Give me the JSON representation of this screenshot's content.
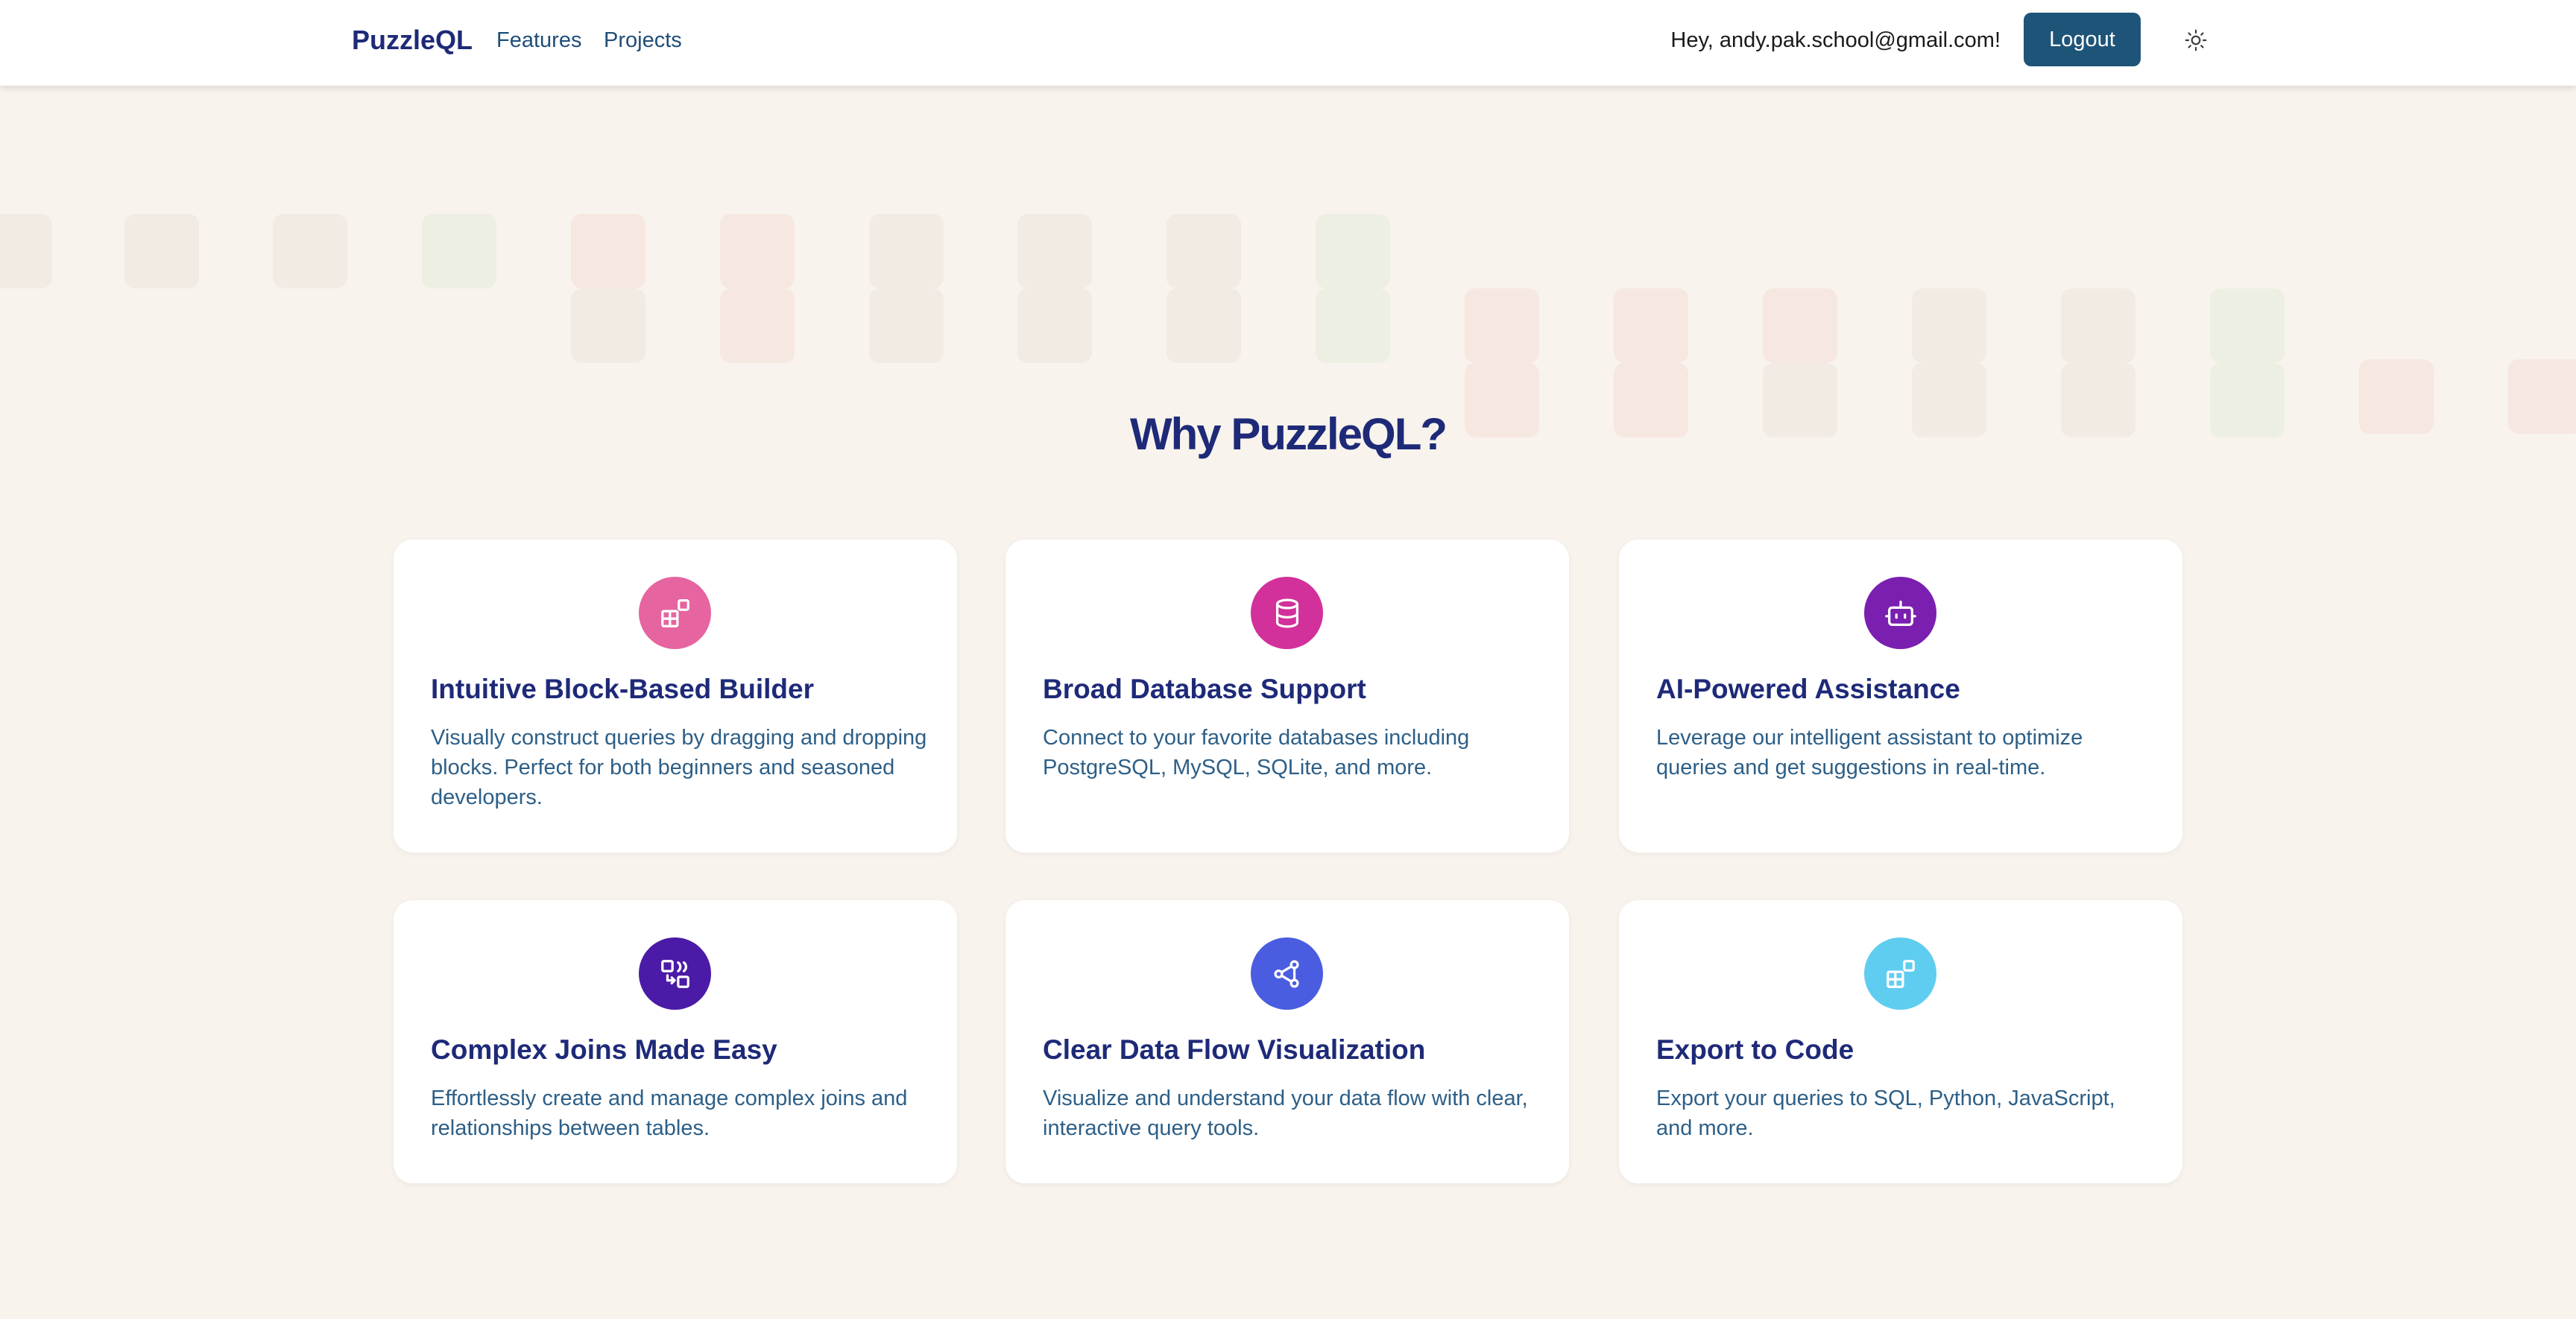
{
  "navbar": {
    "brand": "PuzzleQL",
    "links": [
      {
        "label": "Features"
      },
      {
        "label": "Projects"
      }
    ],
    "greeting": "Hey, andy.pak.school@gmail.com!",
    "logout_label": "Logout",
    "theme_icon": "sun-icon"
  },
  "section": {
    "title": "Why PuzzleQL?"
  },
  "features": [
    {
      "title": "Intuitive Block-Based Builder",
      "description": "Visually construct queries by dragging and dropping blocks. Perfect for both beginners and seasoned developers.",
      "icon": "blocks-icon",
      "icon_color": "#e6649f"
    },
    {
      "title": "Broad Database Support",
      "description": "Connect to your favorite databases including PostgreSQL, MySQL, SQLite, and more.",
      "icon": "database-icon",
      "icon_color": "#d2309a"
    },
    {
      "title": "AI-Powered Assistance",
      "description": "Leverage our intelligent assistant to optimize queries and get suggestions in real-time.",
      "icon": "bot-icon",
      "icon_color": "#7a1fb0"
    },
    {
      "title": "Complex Joins Made Easy",
      "description": "Effortlessly create and manage complex joins and relationships between tables.",
      "icon": "join-icon",
      "icon_color": "#4b1aa6"
    },
    {
      "title": "Clear Data Flow Visualization",
      "description": "Visualize and understand your data flow with clear, interactive query tools.",
      "icon": "workflow-icon",
      "icon_color": "#4a5de0"
    },
    {
      "title": "Export to Code",
      "description": "Export your queries to SQL, Python, JavaScript, and more.",
      "icon": "blocks-icon",
      "icon_color": "#5fcdf0"
    }
  ]
}
